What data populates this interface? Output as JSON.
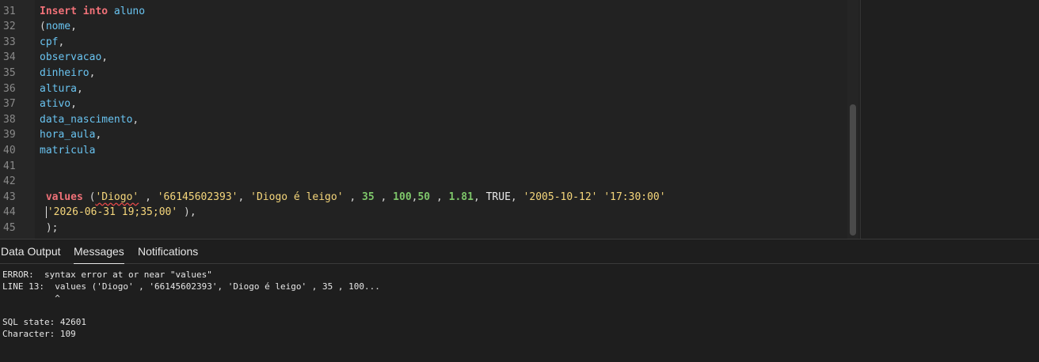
{
  "editor": {
    "lines": [
      {
        "n": "31",
        "tokens": [
          {
            "c": "kw",
            "t": "Insert into"
          },
          {
            "c": "pun",
            "t": " "
          },
          {
            "c": "id",
            "t": "aluno"
          }
        ]
      },
      {
        "n": "32",
        "tokens": [
          {
            "c": "pun",
            "t": "("
          },
          {
            "c": "id",
            "t": "nome"
          },
          {
            "c": "pun",
            "t": ","
          }
        ]
      },
      {
        "n": "33",
        "tokens": [
          {
            "c": "id",
            "t": "cpf"
          },
          {
            "c": "pun",
            "t": ","
          }
        ]
      },
      {
        "n": "34",
        "tokens": [
          {
            "c": "id",
            "t": "observacao"
          },
          {
            "c": "pun",
            "t": ","
          }
        ]
      },
      {
        "n": "35",
        "tokens": [
          {
            "c": "id",
            "t": "dinheiro"
          },
          {
            "c": "pun",
            "t": ","
          }
        ]
      },
      {
        "n": "36",
        "tokens": [
          {
            "c": "id",
            "t": "altura"
          },
          {
            "c": "pun",
            "t": ","
          }
        ]
      },
      {
        "n": "37",
        "tokens": [
          {
            "c": "id",
            "t": "ativo"
          },
          {
            "c": "pun",
            "t": ","
          }
        ]
      },
      {
        "n": "38",
        "tokens": [
          {
            "c": "id",
            "t": "data_nascimento"
          },
          {
            "c": "pun",
            "t": ","
          }
        ]
      },
      {
        "n": "39",
        "tokens": [
          {
            "c": "id",
            "t": "hora_aula"
          },
          {
            "c": "pun",
            "t": ","
          }
        ]
      },
      {
        "n": "40",
        "tokens": [
          {
            "c": "id",
            "t": "matricula"
          }
        ]
      },
      {
        "n": "41",
        "tokens": []
      },
      {
        "n": "42",
        "tokens": []
      },
      {
        "n": "43",
        "tokens": [
          {
            "c": "pun",
            "t": " "
          },
          {
            "c": "kw2",
            "t": "values"
          },
          {
            "c": "pun",
            "t": " ("
          },
          {
            "c": "str squiggle",
            "t": "'Diogo'"
          },
          {
            "c": "pun",
            "t": " , "
          },
          {
            "c": "str",
            "t": "'66145602393'"
          },
          {
            "c": "pun",
            "t": ", "
          },
          {
            "c": "str",
            "t": "'Diogo é leigo'"
          },
          {
            "c": "pun",
            "t": " , "
          },
          {
            "c": "num",
            "t": "35"
          },
          {
            "c": "pun",
            "t": " , "
          },
          {
            "c": "num",
            "t": "100"
          },
          {
            "c": "pun",
            "t": ","
          },
          {
            "c": "num",
            "t": "50"
          },
          {
            "c": "pun",
            "t": " , "
          },
          {
            "c": "num",
            "t": "1.81"
          },
          {
            "c": "pun",
            "t": ", "
          },
          {
            "c": "lit",
            "t": "TRUE"
          },
          {
            "c": "pun",
            "t": ", "
          },
          {
            "c": "str",
            "t": "'2005-10-12'"
          },
          {
            "c": "pun",
            "t": " "
          },
          {
            "c": "str",
            "t": "'17:30:00'"
          }
        ]
      },
      {
        "n": "44",
        "tokens": [
          {
            "c": "pun",
            "t": " "
          },
          {
            "c": "caret",
            "t": ""
          },
          {
            "c": "str",
            "t": "'2026-06-31 19;35;00'"
          },
          {
            "c": "pun",
            "t": " ),"
          }
        ]
      },
      {
        "n": "45",
        "tokens": [
          {
            "c": "pun",
            "t": " );"
          }
        ]
      }
    ]
  },
  "tabs": [
    {
      "label": "Data Output",
      "active": false
    },
    {
      "label": "Messages",
      "active": true
    },
    {
      "label": "Notifications",
      "active": false
    }
  ],
  "messages": [
    "ERROR:  syntax error at or near \"values\"",
    "LINE 13:  values ('Diogo' , '66145602393', 'Diogo é leigo' , 35 , 100...",
    "          ^",
    "",
    "SQL state: 42601",
    "Character: 109"
  ]
}
